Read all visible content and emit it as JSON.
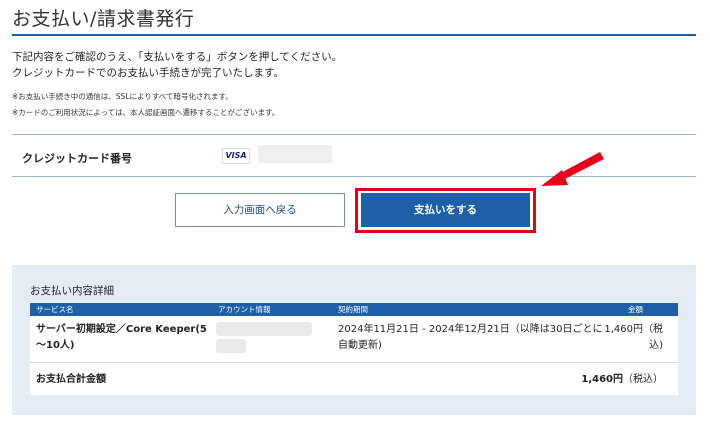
{
  "page": {
    "title": "お支払い/請求書発行",
    "description_line1": "下記内容をご確認のうえ、「支払いをする」ボタンを押してください。",
    "description_line2": "クレジットカードでのお支払い手続きが完了いたします。",
    "note1": "※お支払い手続き中の通信は、SSLによりすべて暗号化されます。",
    "note2": "※カードのご利用状況によっては、本人認証画面へ遷移することがございます。"
  },
  "payment_method": {
    "label": "クレジットカード番号",
    "card_brand": "VISA",
    "card_brand_icon": "visa-card-icon"
  },
  "actions": {
    "back_label": "入力画面へ戻る",
    "pay_label": "支払いをする",
    "highlight_color": "#e6001c"
  },
  "details": {
    "title": "お支払い内容詳細",
    "headers": {
      "service": "サービス名",
      "account": "アカウント情報",
      "period": "契約期間",
      "amount": "金額"
    },
    "row": {
      "service_line1": "サーバー初期設定／Core Keeper(5",
      "service_line2": "～10人)",
      "period_line1": "2024年11月21日 - 2024年12月21日（以降は30日ごとに",
      "period_line2": "自動更新)",
      "amount_line1": "1,460円（税",
      "amount_line2": "込)"
    },
    "total": {
      "label": "お支払合計金額",
      "amount": "1,460円",
      "tax_note": "（税込）"
    }
  },
  "colors": {
    "primary": "#1d5fa8",
    "panel_bg": "#e4edf6",
    "accent_red": "#e6001c"
  }
}
